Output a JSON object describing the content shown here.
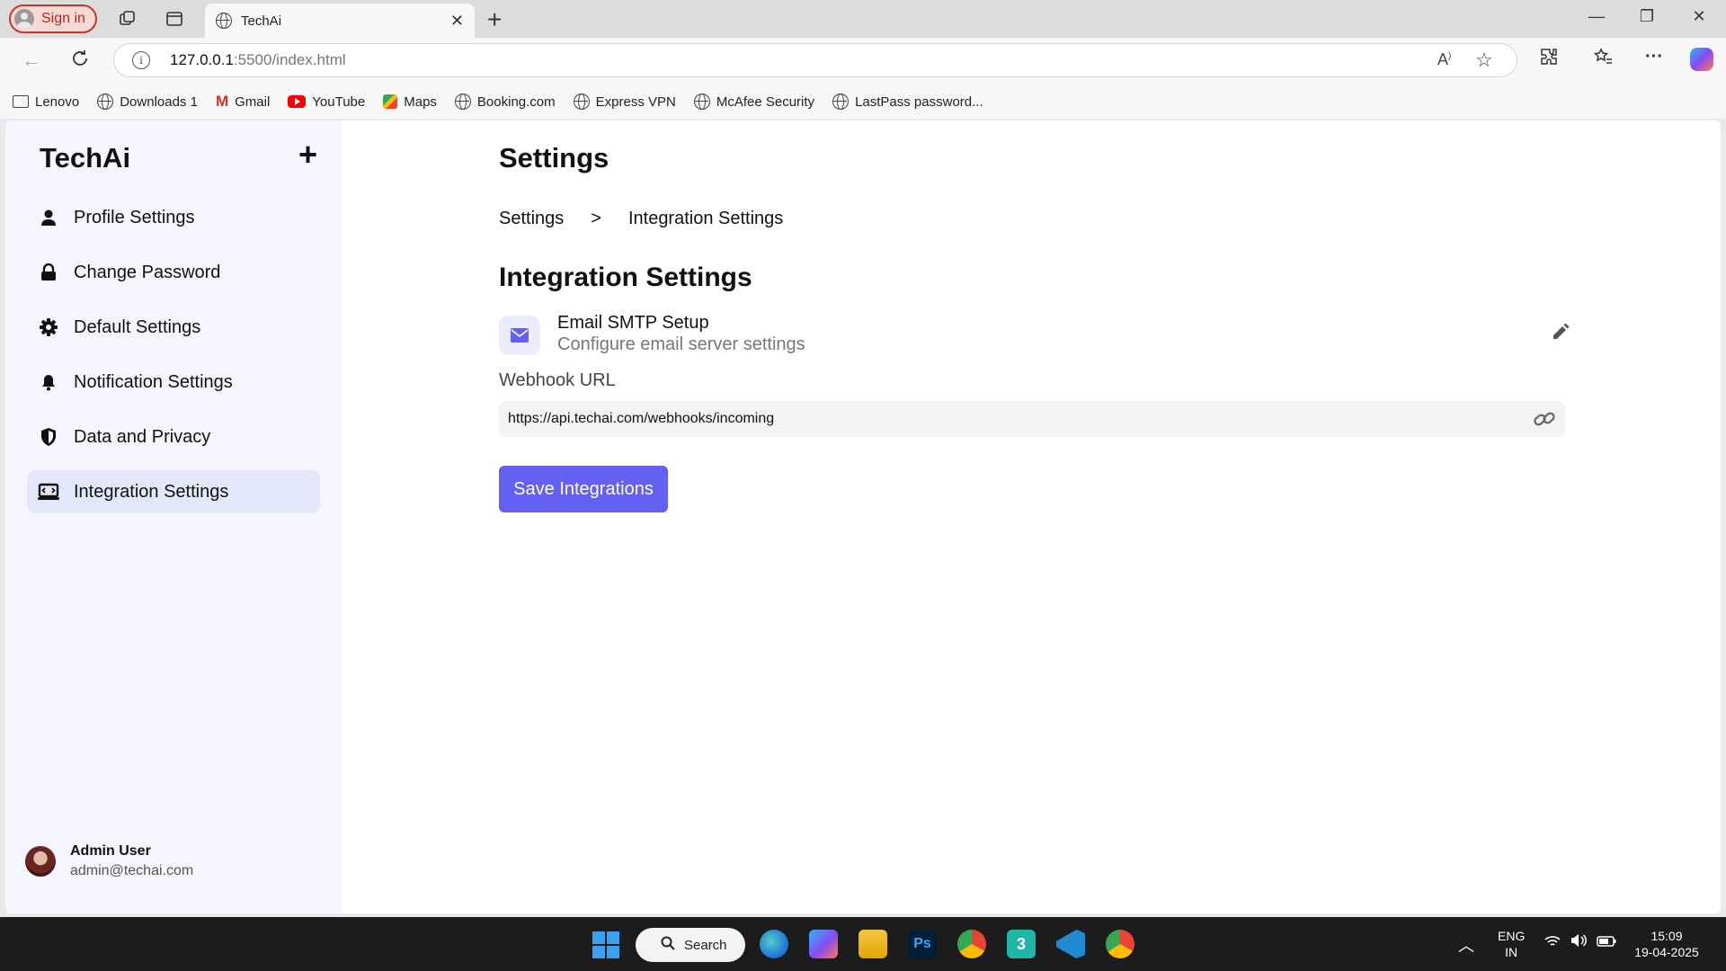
{
  "browser": {
    "signin_label": "Sign in",
    "tab_title": "TechAi",
    "url_host": "127.0.0.1",
    "url_path": ":5500/index.html",
    "bookmarks": [
      "Lenovo",
      "Downloads 1",
      "Gmail",
      "YouTube",
      "Maps",
      "Booking.com",
      "Express VPN",
      "McAfee Security",
      "LastPass password..."
    ]
  },
  "sidebar": {
    "brand": "TechAi",
    "items": [
      {
        "label": "Profile Settings",
        "icon": "user-icon"
      },
      {
        "label": "Change Password",
        "icon": "lock-icon"
      },
      {
        "label": "Default Settings",
        "icon": "gear-icon"
      },
      {
        "label": "Notification Settings",
        "icon": "bell-icon"
      },
      {
        "label": "Data and Privacy",
        "icon": "shield-icon"
      },
      {
        "label": "Integration Settings",
        "icon": "integration-icon",
        "active": true
      }
    ],
    "user": {
      "name": "Admin User",
      "email": "admin@techai.com"
    }
  },
  "main": {
    "title": "Settings",
    "breadcrumb": {
      "parent": "Settings",
      "separator": ">",
      "current": "Integration Settings"
    },
    "section_title": "Integration Settings",
    "smtp": {
      "title": "Email SMTP Setup",
      "description": "Configure email server settings"
    },
    "webhook": {
      "label": "Webhook URL",
      "value": "https://api.techai.com/webhooks/incoming"
    },
    "save_label": "Save Integrations"
  },
  "taskbar": {
    "search_label": "Search",
    "lang": "ENG",
    "region": "IN",
    "time": "15:09",
    "date": "19-04-2025"
  },
  "colors": {
    "accent": "#6461f2",
    "sidebar_bg": "#f5f5fd",
    "active_item_bg": "#e6e6fb"
  }
}
